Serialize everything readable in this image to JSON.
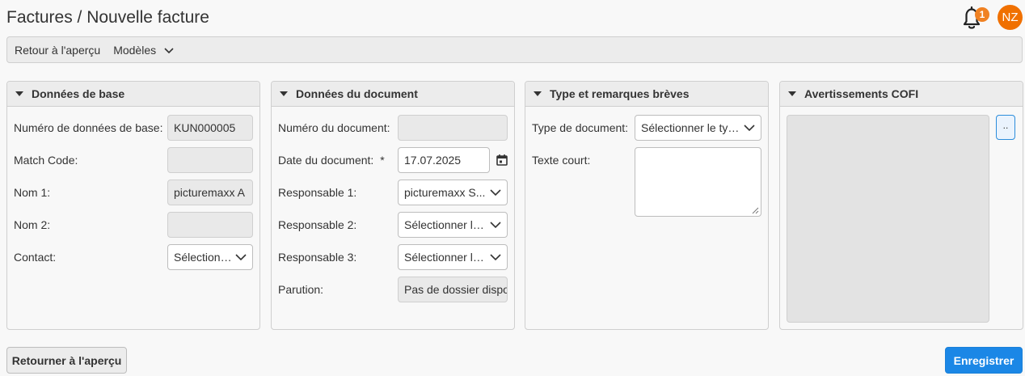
{
  "header": {
    "title": "Factures / Nouvelle facture",
    "notification_count": "1",
    "avatar_initials": "NZ",
    "accent_color": "#f07000"
  },
  "toolbar": {
    "back_label": "Retour à l'aperçu",
    "templates_label": "Modèles"
  },
  "base_data": {
    "title": "Données de base",
    "number_label": "Numéro de données de base:",
    "number_value": "KUN000005",
    "match_code_label": "Match Code:",
    "match_code_value": "",
    "name1_label": "Nom 1:",
    "name1_value": "picturemaxx A",
    "name2_label": "Nom 2:",
    "name2_value": "",
    "contact_label": "Contact:",
    "contact_value": "Sélectionn..."
  },
  "document_data": {
    "title": "Données du document",
    "number_label": "Numéro du document:",
    "number_value": "",
    "date_label": "Date du document:",
    "date_required": "*",
    "date_value": "17.07.2025",
    "resp1_label": "Responsable 1:",
    "resp1_value": "picturemaxx S...",
    "resp2_label": "Responsable 2:",
    "resp2_value": "Sélectionner le...",
    "resp3_label": "Responsable 3:",
    "resp3_value": "Sélectionner le...",
    "issue_label": "Parution:",
    "issue_value": "Pas de dossier dispo"
  },
  "type_remarks": {
    "title": "Type et remarques brèves",
    "doc_type_label": "Type de document:",
    "doc_type_value": "Sélectionner le typ...",
    "short_text_label": "Texte court:"
  },
  "cofi": {
    "title": "Avertissements COFI",
    "button_label": ".."
  },
  "footer": {
    "back_button": "Retourner à l'aperçu",
    "save_button": "Enregistrer",
    "save_color": "#1b87e6"
  }
}
